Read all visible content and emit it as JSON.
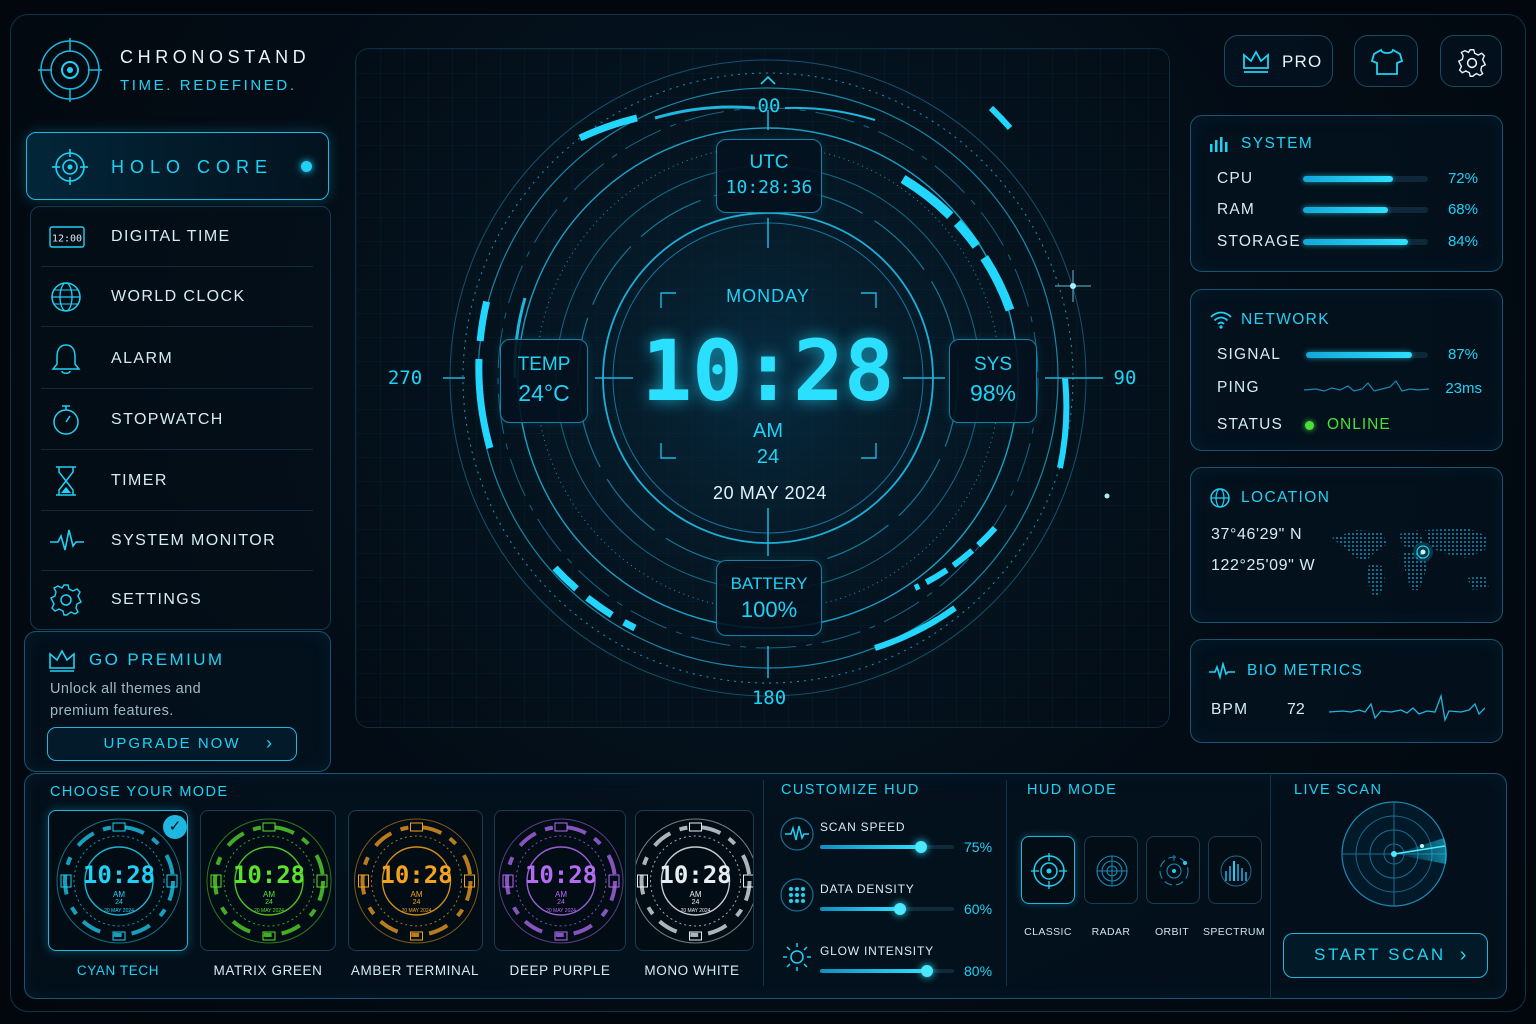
{
  "brand": {
    "name": "CHRONOSTAND",
    "tagline": "TIME. REDEFINED."
  },
  "sidebar": {
    "active": {
      "label": "HOLO CORE",
      "icon": "target-icon"
    },
    "items": [
      {
        "label": "DIGITAL TIME",
        "icon": "digital-clock-icon",
        "icon_text": "12:00"
      },
      {
        "label": "WORLD CLOCK",
        "icon": "globe-icon"
      },
      {
        "label": "ALARM",
        "icon": "bell-icon"
      },
      {
        "label": "STOPWATCH",
        "icon": "stopwatch-icon"
      },
      {
        "label": "TIMER",
        "icon": "hourglass-icon"
      },
      {
        "label": "SYSTEM MONITOR",
        "icon": "pulse-icon"
      },
      {
        "label": "SETTINGS",
        "icon": "gear-icon"
      }
    ]
  },
  "premium": {
    "title": "GO PREMIUM",
    "desc_line1": "Unlock all themes and",
    "desc_line2": "premium features.",
    "button": "UPGRADE NOW"
  },
  "top_buttons": {
    "pro_label": "PRO"
  },
  "hud": {
    "compass_top": "00",
    "compass_right": "90",
    "compass_bottom": "180",
    "compass_left": "270",
    "utc_label": "UTC",
    "utc_time": "10:28:36",
    "day": "MONDAY",
    "time": "10:28",
    "ampm": "AM",
    "seconds": "24",
    "date": "20 MAY 2024",
    "temp_label": "TEMP",
    "temp_value": "24°C",
    "sys_label": "SYS",
    "sys_value": "98%",
    "battery_label": "BATTERY",
    "battery_value": "100%"
  },
  "system": {
    "title": "SYSTEM",
    "rows": [
      {
        "label": "CPU",
        "value": "72%",
        "fraction": 0.72
      },
      {
        "label": "RAM",
        "value": "68%",
        "fraction": 0.68
      },
      {
        "label": "STORAGE",
        "value": "84%",
        "fraction": 0.84
      }
    ]
  },
  "network": {
    "title": "NETWORK",
    "signal_label": "SIGNAL",
    "signal_value": "87%",
    "signal_fraction": 0.87,
    "ping_label": "PING",
    "ping_value": "23ms",
    "status_label": "STATUS",
    "status_value": "ONLINE",
    "status_color": "#4ade3a"
  },
  "location": {
    "title": "LOCATION",
    "lat": "37°46'29\" N",
    "lon": "122°25'09\" W"
  },
  "bio": {
    "title": "BIO METRICS",
    "bpm_label": "BPM",
    "bpm_value": "72"
  },
  "modes": {
    "title": "CHOOSE YOUR MODE",
    "themes": [
      {
        "label": "CYAN TECH",
        "color": "#1fd2f5",
        "selected": true
      },
      {
        "label": "MATRIX GREEN",
        "color": "#5be22a",
        "selected": false
      },
      {
        "label": "AMBER TERMINAL",
        "color": "#f5a21f",
        "selected": false
      },
      {
        "label": "DEEP PURPLE",
        "color": "#b46cf5",
        "selected": false
      },
      {
        "label": "MONO WHITE",
        "color": "#e6eef2",
        "selected": false
      }
    ],
    "preview_time": "10:28",
    "preview_ampm": "AM",
    "preview_sec": "24",
    "preview_date": "20 MAY 2024"
  },
  "customize": {
    "title": "CUSTOMIZE HUD",
    "sliders": [
      {
        "label": "SCAN SPEED",
        "value": "75%",
        "fraction": 0.75,
        "icon": "wave-icon"
      },
      {
        "label": "DATA DENSITY",
        "value": "60%",
        "fraction": 0.6,
        "icon": "grid-dots-icon"
      },
      {
        "label": "GLOW INTENSITY",
        "value": "80%",
        "fraction": 0.8,
        "icon": "sun-icon"
      }
    ]
  },
  "hud_mode": {
    "title": "HUD MODE",
    "options": [
      {
        "label": "CLASSIC",
        "active": true
      },
      {
        "label": "RADAR",
        "active": false
      },
      {
        "label": "ORBIT",
        "active": false
      },
      {
        "label": "SPECTRUM",
        "active": false
      }
    ]
  },
  "live_scan": {
    "title": "LIVE SCAN",
    "button": "START SCAN"
  }
}
